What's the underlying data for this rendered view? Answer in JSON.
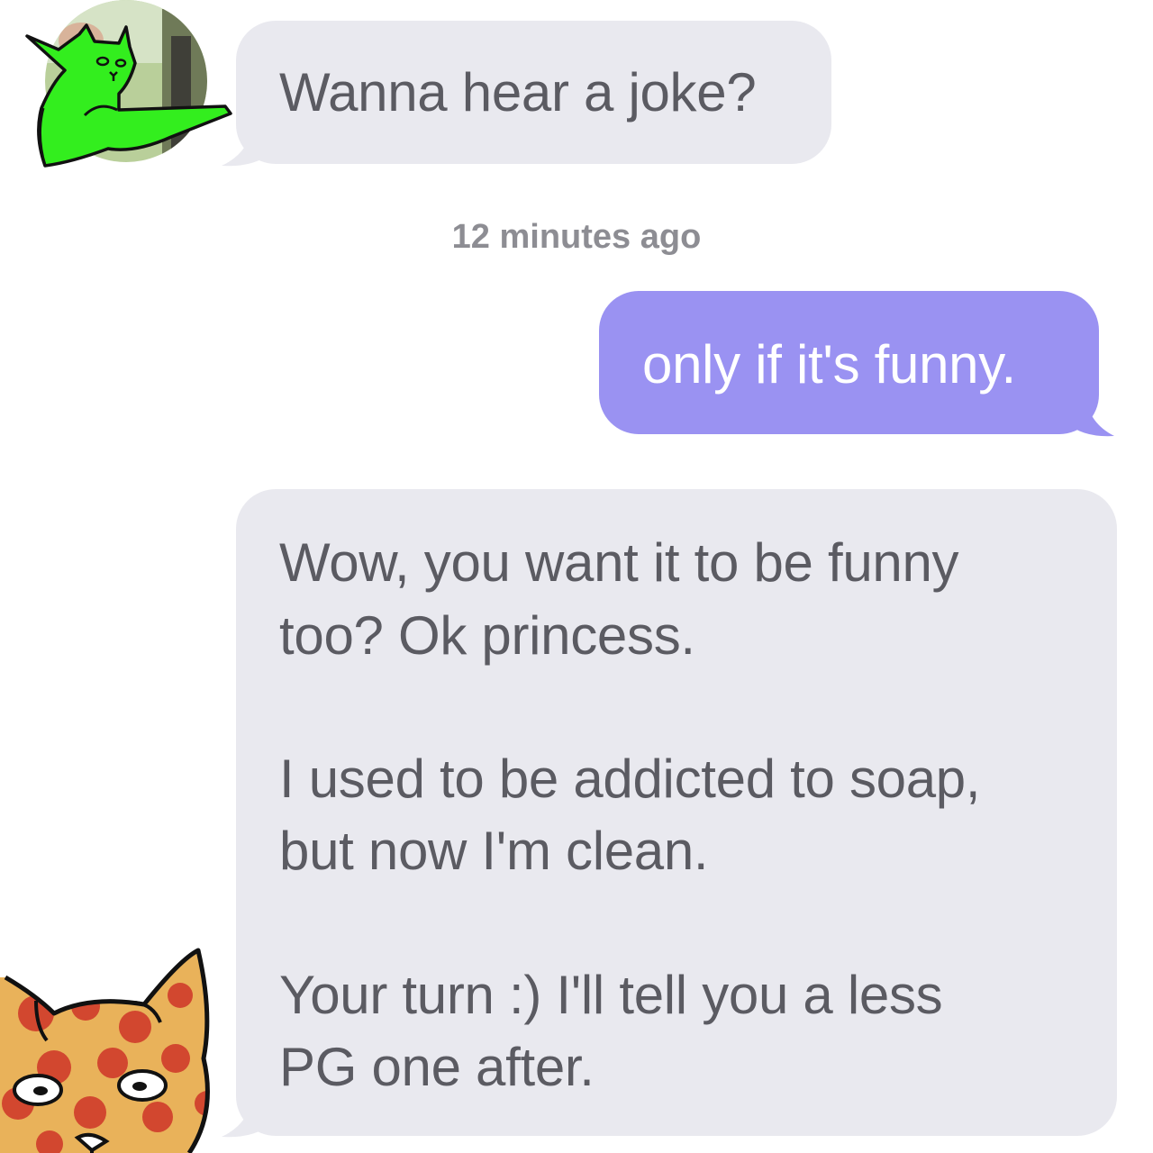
{
  "conversation": {
    "messages": [
      {
        "direction": "incoming",
        "text": "Wanna hear a joke?"
      },
      {
        "direction": "outgoing",
        "text": "only if it's funny."
      },
      {
        "direction": "incoming",
        "lines": [
          "Wow, you want it to be funny",
          "too? Ok princess.",
          "I used to be addicted to soap,",
          "but now I'm clean.",
          "Your turn :) I'll tell you a less",
          "PG one after."
        ]
      }
    ],
    "timestamp": "12 minutes ago"
  },
  "avatars": {
    "top": {
      "icon": "green-cat-avatar-icon"
    },
    "bottom": {
      "icon": "pizza-cat-avatar-icon"
    }
  },
  "colors": {
    "incoming_bubble": "#e9e9ef",
    "outgoing_bubble": "#9a92f2",
    "incoming_text": "#5b5b62",
    "outgoing_text": "#ffffff",
    "timestamp": "#8d8d93",
    "sticker_green": "#33ee1e"
  }
}
